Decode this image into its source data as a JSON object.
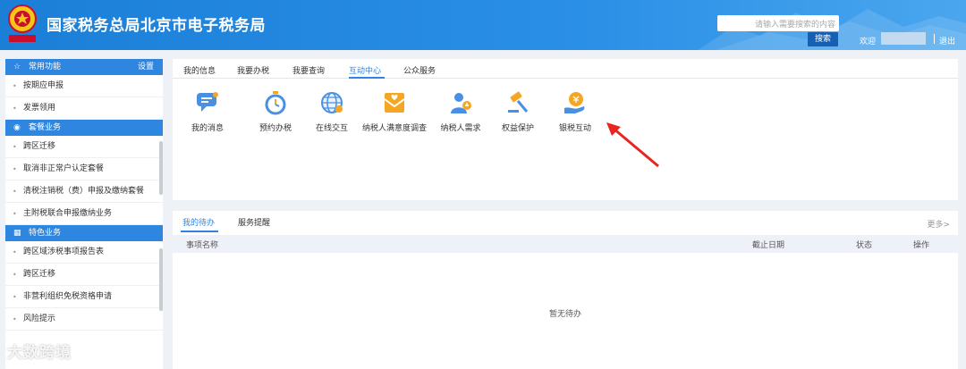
{
  "header": {
    "site_title": "国家税务总局北京市电子税务局",
    "search_placeholder": "请输入需要搜索的内容",
    "search_button": "搜索",
    "welcome": "欢迎",
    "logout": "退出",
    "emblem_icon": "tax-emblem-icon",
    "colors": {
      "header_blue": "#1b7fd8",
      "accent_blue": "#2f86e0"
    }
  },
  "sidebar": {
    "sections": [
      {
        "title": "常用功能",
        "icon": "star-icon",
        "settings": "设置",
        "items": [
          "按期应申报",
          "发票领用"
        ]
      },
      {
        "title": "套餐业务",
        "icon": "cube-icon",
        "items": [
          "跨区迁移",
          "取消非正常户认定套餐",
          "清税注销税（费）申报及缴纳套餐",
          "主附税联合申报缴纳业务"
        ]
      },
      {
        "title": "特色业务",
        "icon": "grid-icon",
        "items": [
          "跨区域涉税事项报告表",
          "跨区迁移",
          "非营利组织免税资格申请",
          "风险提示"
        ]
      }
    ]
  },
  "main_tabs": [
    "我的信息",
    "我要办税",
    "我要查询",
    "互动中心",
    "公众服务"
  ],
  "active_main_tab": "互动中心",
  "functions": [
    {
      "label": "我的消息",
      "icon": "message-icon"
    },
    {
      "label": "预约办税",
      "icon": "stopwatch-icon"
    },
    {
      "label": "在线交互",
      "icon": "globe-icon"
    },
    {
      "label": "纳税人满意度调查",
      "icon": "survey-envelope-icon"
    },
    {
      "label": "纳税人需求",
      "icon": "person-request-icon"
    },
    {
      "label": "权益保护",
      "icon": "gavel-icon"
    },
    {
      "label": "银税互动",
      "icon": "bank-tax-icon"
    }
  ],
  "todo": {
    "tabs": [
      "我的待办",
      "服务提醒"
    ],
    "more": "更多>",
    "columns": [
      "事项名称",
      "截止日期",
      "状态",
      "操作"
    ],
    "empty_text": "暂无待办"
  },
  "watermark": "大数跨境"
}
